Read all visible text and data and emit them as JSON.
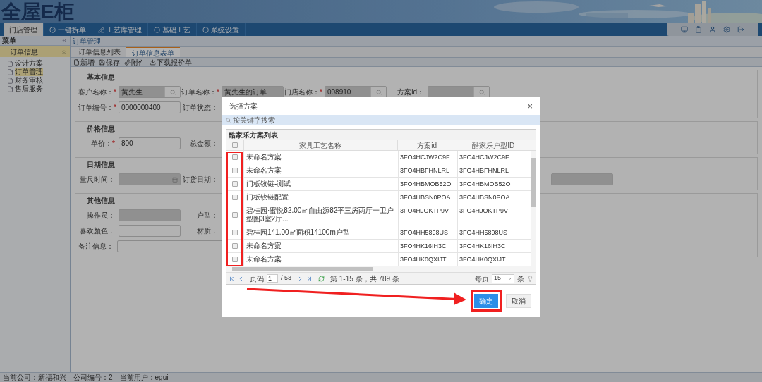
{
  "header": {
    "logo": "全屋E柜"
  },
  "nav_tabs": [
    {
      "label": "门店管理",
      "selected": true
    },
    {
      "label": "一键拆单",
      "selected": false
    },
    {
      "label": "工艺库管理",
      "selected": false
    },
    {
      "label": "基础工艺",
      "selected": false
    },
    {
      "label": "系统设置",
      "selected": false
    }
  ],
  "sidebar": {
    "title": "菜单",
    "section": "订单信息",
    "items": [
      {
        "label": "设计方案",
        "selected": false
      },
      {
        "label": "订单管理",
        "selected": true
      },
      {
        "label": "财务审核",
        "selected": false
      },
      {
        "label": "售后服务",
        "selected": false
      }
    ]
  },
  "breadcrumb": "订单管理",
  "content_tabs": [
    {
      "label": "订单信息列表",
      "selected": false
    },
    {
      "label": "订单信息表单",
      "selected": true
    }
  ],
  "toolbar": [
    "新增",
    "保存",
    "附件",
    "下载报价单"
  ],
  "form": {
    "groups": [
      {
        "title": "基本信息",
        "rows": [
          [
            {
              "kind": "lookup",
              "label": "客户名称：",
              "mark": "*",
              "value": "黄先生",
              "disabled": true
            },
            {
              "kind": "text",
              "label": "订单名称：",
              "mark": "*",
              "value": "黄先生的订单",
              "disabled": true
            },
            {
              "kind": "lookup",
              "label": "门店名称：",
              "mark": "*",
              "value": "008910",
              "disabled": true
            },
            {
              "kind": "lookup",
              "label": "方案id：",
              "disabled": true
            }
          ],
          [
            {
              "kind": "text",
              "label": "订单编号：",
              "mark": "*",
              "value": "0000000400",
              "disabled": false
            },
            {
              "kind": "label_only",
              "label": "订单状态："
            }
          ]
        ]
      },
      {
        "title": "价格信息",
        "rows": [
          [
            {
              "kind": "text",
              "label": "单价：",
              "mark": "*",
              "value": "800",
              "disabled": false
            },
            {
              "kind": "label_only",
              "label": "总金额："
            }
          ]
        ]
      },
      {
        "title": "日期信息",
        "rows": [
          [
            {
              "kind": "date",
              "label": "量尺时间：",
              "disabled": true
            },
            {
              "kind": "label_only",
              "label": "订货日期："
            },
            {
              "kind": "field_only",
              "disabled": true
            }
          ]
        ]
      },
      {
        "title": "其他信息",
        "rows": [
          [
            {
              "kind": "text",
              "label": "操作员：",
              "disabled": true
            },
            {
              "kind": "label_only",
              "label": "户型："
            }
          ],
          [
            {
              "kind": "text",
              "label": "喜欢颜色：",
              "disabled": false
            },
            {
              "kind": "label_only",
              "label": "材质："
            }
          ],
          [
            {
              "kind": "wide",
              "label": "备注信息：",
              "disabled": false
            }
          ]
        ]
      }
    ]
  },
  "modal": {
    "title": "选择方案",
    "close": "×",
    "search_placeholder": "按关键字搜索",
    "grid": {
      "title": "酷家乐方案列表",
      "columns": [
        "家具工艺名称",
        "方案id",
        "酷家乐户型ID"
      ],
      "header_checked": false,
      "rows": [
        {
          "name": "未命名方案",
          "plan_id": "3FO4HCJW2C9F",
          "layout_id": "3FO4HCJW2C9F",
          "checked": false
        },
        {
          "name": "未命名方案",
          "plan_id": "3FO4HBFHNLRL",
          "layout_id": "3FO4HBFHNLRL",
          "checked": false
        },
        {
          "name": "门板铰链-测试",
          "plan_id": "3FO4HBMOB52O",
          "layout_id": "3FO4HBMOB52O",
          "checked": false
        },
        {
          "name": "门板铰链配置",
          "plan_id": "3FO4HBSN0POA",
          "layout_id": "3FO4HBSN0POA",
          "checked": false
        },
        {
          "name": "碧桂园·蜜悦82.00㎡自由源82平三房两厅一卫户型图3室2厅...",
          "plan_id": "3FO4HJOKTP9V",
          "layout_id": "3FO4HJOKTP9V",
          "checked": false
        },
        {
          "name": "碧桂园141.00㎡面积14100m户型",
          "plan_id": "3FO4HH5898US",
          "layout_id": "3FO4HH5898US",
          "checked": false
        },
        {
          "name": "未命名方案",
          "plan_id": "3FO4HK16IH3C",
          "layout_id": "3FO4HK16IH3C",
          "checked": false
        },
        {
          "name": "未命名方案",
          "plan_id": "3FO4HK0QXIJT",
          "layout_id": "3FO4HK0QXIJT",
          "checked": false
        }
      ]
    },
    "pager": {
      "page_label": "页码",
      "page": "1",
      "total_pages": "/ 53",
      "summary": "第 1-15 条，共 789 条",
      "per_page_label": "每页",
      "per_page": "15",
      "per_page_unit": "条"
    },
    "buttons": [
      {
        "label": "确定",
        "kind": "primary"
      },
      {
        "label": "取消",
        "kind": "secondary"
      }
    ]
  },
  "status_bar": [
    "当前公司：新福和兴",
    "公司编号：2",
    "当前用户：egui"
  ]
}
